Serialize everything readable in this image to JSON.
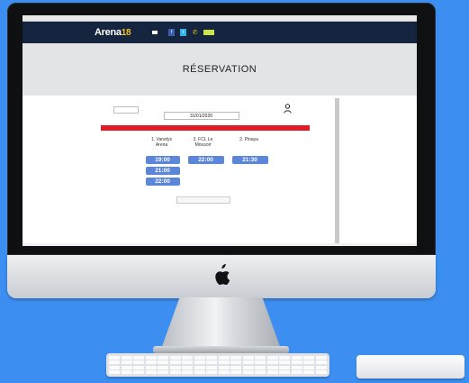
{
  "mac_menu": [
    "",
    "",
    "",
    "",
    "",
    "",
    ""
  ],
  "site": {
    "logo_text": "Arena",
    "logo_number": "18",
    "nav": [
      "",
      "",
      "",
      "",
      ""
    ],
    "reserve_label": ""
  },
  "page": {
    "title": "RÉSERVATION"
  },
  "booking": {
    "lang_select": "",
    "choose_label": "",
    "date": "31/01/2020",
    "availability_banner": "",
    "courts": [
      {
        "label": "1. Vanelys Arena",
        "slots": [
          "19:00",
          "21:00",
          "22:00"
        ]
      },
      {
        "label": "3. FCL Le Mousoir",
        "slots": [
          "22:00"
        ]
      },
      {
        "label": "2. Pinaya",
        "slots": [
          "21:30"
        ]
      }
    ],
    "all_slots_label": ""
  },
  "colors": {
    "background": "#3d8ef1",
    "nav": "#16253f",
    "accent_red": "#e31b23",
    "slot_blue": "#5b86d9",
    "reserve_green": "#c8e64a"
  },
  "icons": [
    "apple-icon",
    "user-icon",
    "facebook-icon",
    "twitter-icon",
    "phone-icon"
  ]
}
